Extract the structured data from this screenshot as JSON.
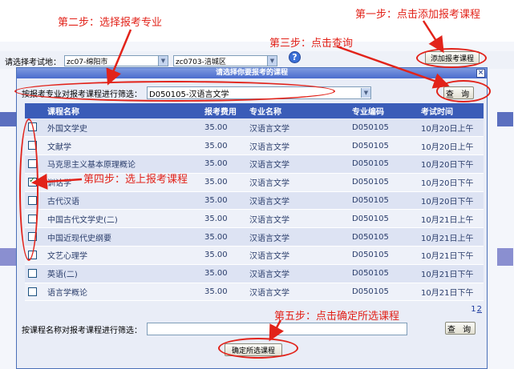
{
  "background": {
    "exam_area_label": "请选择考试地：",
    "city_select": "zc07-绵阳市",
    "district_select": "zc0703-涪城区",
    "add_button": "添加报考课程"
  },
  "modal": {
    "title": "请选择你要报考的课程",
    "close": "×",
    "major_filter_label": "按报考专业对报考课程进行筛选：",
    "major_selected": "D050105-汉语言文学",
    "query_label": "查 询",
    "columns": [
      "课程名称",
      "报考费用",
      "专业名称",
      "专业编码",
      "考试时间"
    ],
    "rows": [
      {
        "checked": false,
        "name": "外国文学史",
        "fee": "35.00",
        "major": "汉语言文学",
        "code": "D050105",
        "time": "10月20日上午"
      },
      {
        "checked": false,
        "name": "文献学",
        "fee": "35.00",
        "major": "汉语言文学",
        "code": "D050105",
        "time": "10月20日上午"
      },
      {
        "checked": false,
        "name": "马克思主义基本原理概论",
        "fee": "35.00",
        "major": "汉语言文学",
        "code": "D050105",
        "time": "10月20日下午"
      },
      {
        "checked": true,
        "name": "训诂学",
        "fee": "35.00",
        "major": "汉语言文学",
        "code": "D050105",
        "time": "10月20日下午"
      },
      {
        "checked": false,
        "name": "古代汉语",
        "fee": "35.00",
        "major": "汉语言文学",
        "code": "D050105",
        "time": "10月20日下午"
      },
      {
        "checked": false,
        "name": "中国古代文学史(二)",
        "fee": "35.00",
        "major": "汉语言文学",
        "code": "D050105",
        "time": "10月21日上午"
      },
      {
        "checked": false,
        "name": "中国近现代史纲要",
        "fee": "35.00",
        "major": "汉语言文学",
        "code": "D050105",
        "time": "10月21日上午"
      },
      {
        "checked": false,
        "name": "文艺心理学",
        "fee": "35.00",
        "major": "汉语言文学",
        "code": "D050105",
        "time": "10月21日下午"
      },
      {
        "checked": false,
        "name": "英语(二)",
        "fee": "35.00",
        "major": "汉语言文学",
        "code": "D050105",
        "time": "10月21日下午"
      },
      {
        "checked": false,
        "name": "语言学概论",
        "fee": "35.00",
        "major": "汉语言文学",
        "code": "D050105",
        "time": "10月21日下午"
      }
    ],
    "pages": [
      "1",
      "2"
    ],
    "name_filter_label": "按课程名称对报考课程进行筛选：",
    "name_filter_value": "",
    "confirm_label": "确定所选课程"
  },
  "annotations": {
    "step1": "第一步：点击添加报考课程",
    "step2": "第二步：选择报考专业",
    "step3": "第三步：点击查询",
    "step4": "第四步：选上报考课程",
    "step5": "第五步：点击确定所选课程"
  },
  "colors": {
    "annotation": "#e2231a",
    "header": "#3a5cb8",
    "title_bar": "#4a6ccd"
  }
}
